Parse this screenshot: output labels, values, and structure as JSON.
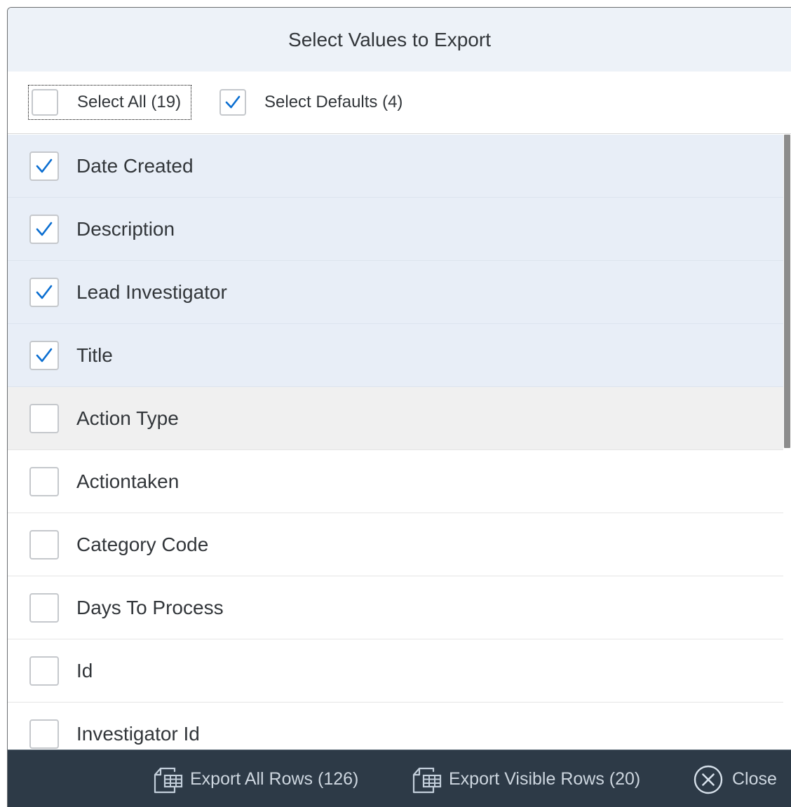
{
  "dialog": {
    "title": "Select Values to Export"
  },
  "toolbar": {
    "select_all_label": "Select All (19)",
    "select_all_checked": false,
    "select_defaults_label": "Select Defaults (4)",
    "select_defaults_checked": true
  },
  "fields": [
    {
      "label": "Date Created",
      "checked": true
    },
    {
      "label": "Description",
      "checked": true
    },
    {
      "label": "Lead Investigator",
      "checked": true
    },
    {
      "label": "Title",
      "checked": true
    },
    {
      "label": "Action Type",
      "checked": false
    },
    {
      "label": "Actiontaken",
      "checked": false
    },
    {
      "label": "Category Code",
      "checked": false
    },
    {
      "label": "Days To Process",
      "checked": false
    },
    {
      "label": "Id",
      "checked": false
    },
    {
      "label": "Investigator Id",
      "checked": false
    }
  ],
  "footer": {
    "export_all_label": "Export All Rows (126)",
    "export_visible_label": "Export Visible Rows (20)",
    "close_label": "Close"
  },
  "colors": {
    "accent": "#0a6ed1",
    "selected_row": "#e8eef7",
    "footer_bg": "#2d3a47"
  },
  "icons": {
    "export": "spreadsheet-export-icon",
    "close": "circle-x-icon",
    "check": "checkmark-icon"
  }
}
